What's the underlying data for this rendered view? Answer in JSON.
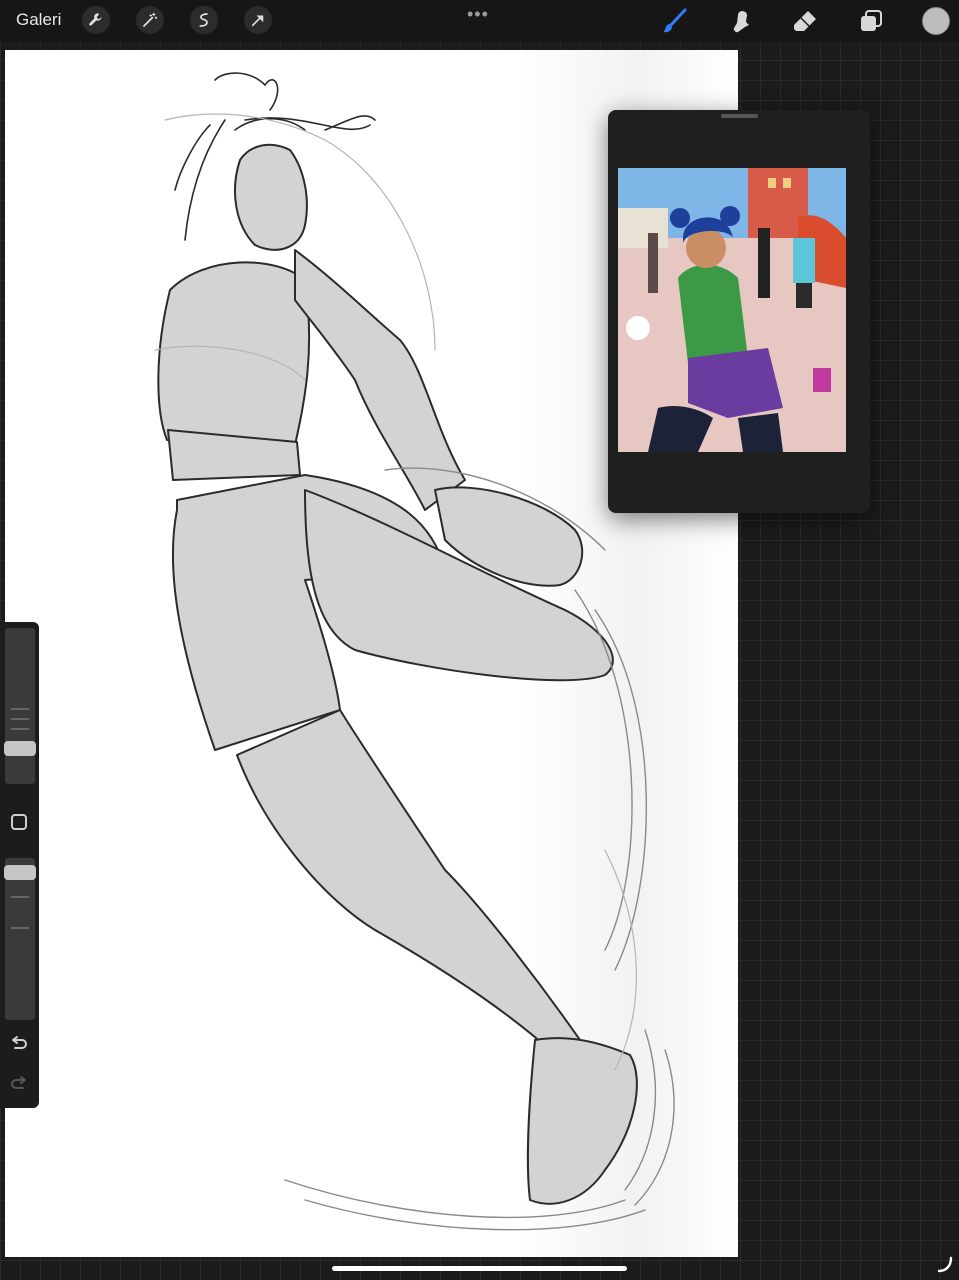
{
  "topbar": {
    "gallery_label": "Galeri",
    "left_tools": [
      "wrench-icon",
      "magic-wand-icon",
      "selection-icon",
      "transform-arrow-icon"
    ],
    "more_label": "•••",
    "right_tools": [
      "brush-icon",
      "smudge-icon",
      "eraser-icon",
      "layers-icon"
    ],
    "accent_color": "#2f7cf6",
    "current_color": "#bdbdbd"
  },
  "sidebar": {
    "brush_size_level": 0.2,
    "opacity_level": 0.95,
    "undo_icon": "undo-icon",
    "redo_icon": "redo-icon"
  }
}
